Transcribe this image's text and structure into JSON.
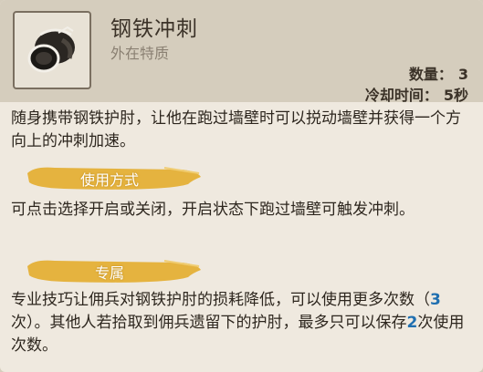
{
  "item": {
    "icon": "steel-bracer-icon",
    "name": "钢铁冲刺",
    "type": "外在特质",
    "count_label": "数量：",
    "count_value": "3",
    "cooldown_label": "冷却时间：",
    "cooldown_value": "5秒"
  },
  "description": "随身携带钢铁护肘，让他在跑过墙壁时可以捝动墙壁并获得一个方向上的冲刺加速。",
  "usage": {
    "heading": "使用方式",
    "text": "可点击选择开启或关闭，开启状态下跑过墙壁可触发冲刺。"
  },
  "exclusive": {
    "heading": "专属",
    "text_a": "专业技巧让佣兵对钢铁护肘的损耗降低，可以使用更多次数（",
    "highlight_a": "3",
    "text_b": "次）。其他人若拾取到佣兵遗留下的护肘，最多只可以保存",
    "highlight_b": "2",
    "text_c": "次使用次数。"
  },
  "colors": {
    "banner": "#e5b33f",
    "highlight": "#1f6fb0",
    "header_bg": "#d5cdbd",
    "body_bg": "#efe9df"
  }
}
